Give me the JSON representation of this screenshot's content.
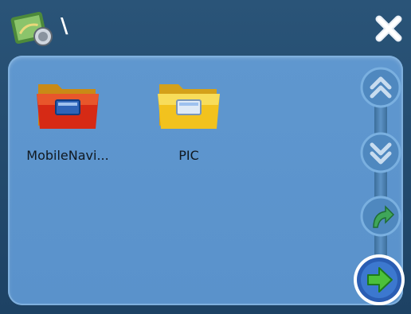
{
  "title_bar": {
    "app_icon": "map-globe-icon",
    "path": "\\",
    "close_icon": "close-icon"
  },
  "files": [
    {
      "name": "MobileNavi...",
      "icon": "folder-red-icon"
    },
    {
      "name": "PIC",
      "icon": "folder-yellow-icon"
    }
  ],
  "navigation": {
    "page_up_icon": "double-chevron-up-icon",
    "page_down_icon": "double-chevron-down-icon",
    "back_icon": "curved-arrow-icon",
    "confirm_icon": "arrow-right-icon"
  },
  "colors": {
    "background": "#1e4466",
    "panel": "#5f97cf",
    "confirm": "#2a5db3"
  }
}
